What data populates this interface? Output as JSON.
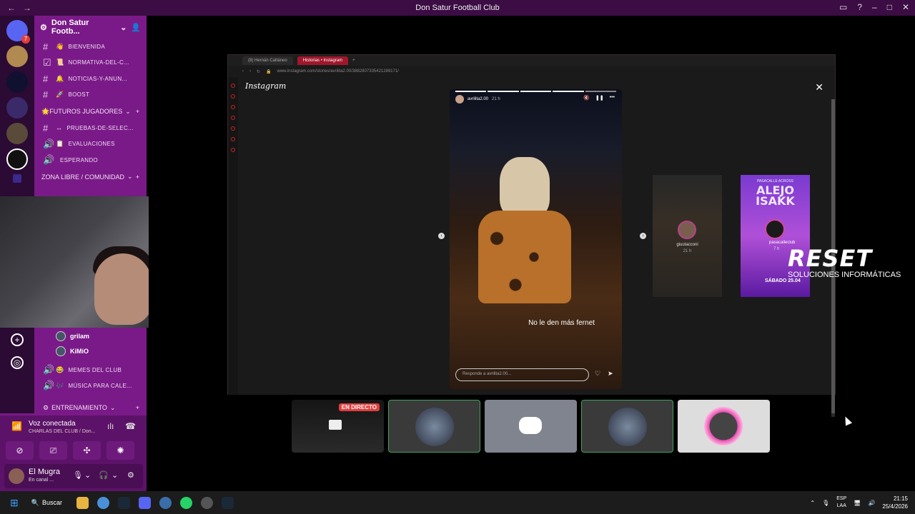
{
  "window": {
    "title": "Don Satur Football Club"
  },
  "servers": {
    "dm_badge": "7"
  },
  "guild": {
    "name": "Don Satur Footb..."
  },
  "channels": [
    {
      "icon": "👋",
      "name": "bienvenida"
    },
    {
      "icon": "📜",
      "name": "normativa-del-c..."
    },
    {
      "icon": "🔔",
      "name": "noticias-y-anun..."
    },
    {
      "icon": "🚀",
      "name": "boost"
    }
  ],
  "categories": {
    "futuros": "🌟FUTUROS JUGADORES",
    "zona": "ZONA LIBRE / COMUNIDAD",
    "entrenamiento": "ENTRENAMIENTO"
  },
  "futuros_channels": [
    {
      "icon": "↔",
      "name": "pruebas-de-selec..."
    },
    {
      "icon": "📋",
      "name": "evaluaciones"
    },
    {
      "icon": "",
      "name": "esperando"
    }
  ],
  "voice_users": [
    {
      "name": "grilam"
    },
    {
      "name": "KiMiO"
    }
  ],
  "voice_channels": [
    {
      "icon": "😂",
      "name": "memes del club"
    },
    {
      "icon": "🎶",
      "name": "música para cale..."
    }
  ],
  "voice": {
    "status": "Voz conectada",
    "channel": "CHARLAS DEL CLUB / Don..."
  },
  "user": {
    "name": "El Mugra",
    "status": "En canal ..."
  },
  "browser": {
    "tabs": [
      "(8) Hernán Cattáneo",
      "Historias • Instagram"
    ],
    "url": "www.instagram.com/stories/avrilita2.00/3882807335421289171/"
  },
  "instagram": {
    "logo": "Instagram",
    "story_user": "avrilita2.00",
    "story_time": "21 h",
    "caption": "No le den más fernet",
    "reply_placeholder": "Responde a avrilita2.00...",
    "next_user": "giuutacconi",
    "next_time": "21 h",
    "promo_top": "PASACALLE ACROSS",
    "promo_title": "ALEJO ISAKK",
    "promo_user": "pasacalleclub",
    "promo_time": "7 h",
    "promo_date": "SÁBADO 25.04"
  },
  "watermark": {
    "brand": "RESET",
    "tagline": "SOLUCIONES INFORMÁTICAS"
  },
  "stream": {
    "live_label": "EN DIRECTO"
  },
  "taskbar": {
    "search": "Buscar",
    "lang_top": "ESP",
    "lang_bottom": "LAA",
    "time": "21:15",
    "date": "25/4/2026"
  }
}
